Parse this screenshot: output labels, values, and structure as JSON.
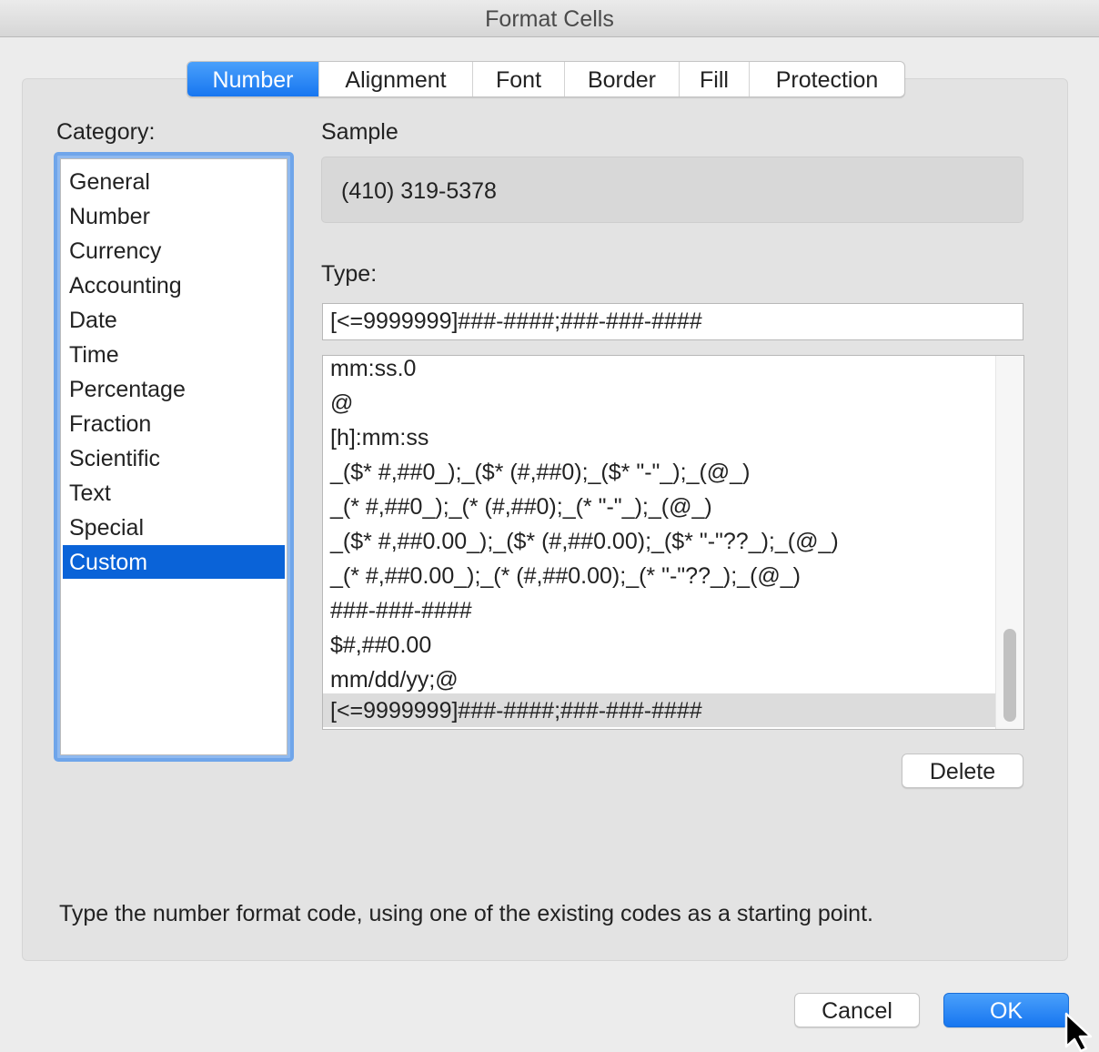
{
  "window": {
    "title": "Format Cells"
  },
  "tabs": [
    {
      "label": "Number",
      "active": true
    },
    {
      "label": "Alignment",
      "active": false
    },
    {
      "label": "Font",
      "active": false
    },
    {
      "label": "Border",
      "active": false
    },
    {
      "label": "Fill",
      "active": false
    },
    {
      "label": "Protection",
      "active": false
    }
  ],
  "category": {
    "label": "Category:",
    "items": [
      "General",
      "Number",
      "Currency",
      "Accounting",
      "Date",
      "Time",
      "Percentage",
      "Fraction",
      "Scientific",
      "Text",
      "Special",
      "Custom"
    ],
    "selected": "Custom"
  },
  "sample": {
    "label": "Sample",
    "value": "(410) 319-5378"
  },
  "type": {
    "label": "Type:",
    "value": "[<=9999999]###-####;###-###-####",
    "formats": [
      "mm:ss.0",
      "@",
      "[h]:mm:ss",
      "_($* #,##0_);_($* (#,##0);_($* \"-\"_);_(@_)",
      "_(* #,##0_);_(* (#,##0);_(* \"-\"_);_(@_)",
      "_($* #,##0.00_);_($* (#,##0.00);_($* \"-\"??_);_(@_)",
      "_(* #,##0.00_);_(* (#,##0.00);_(* \"-\"??_);_(@_)",
      "###-###-####",
      "$#,##0.00",
      "mm/dd/yy;@",
      "[<=9999999]###-####;###-###-####"
    ],
    "selected_format": "[<=9999999]###-####;###-###-####"
  },
  "buttons": {
    "delete": "Delete",
    "cancel": "Cancel",
    "ok": "OK"
  },
  "hint": "Type the number format code, using one of the existing codes as a starting point.",
  "colors": {
    "accent": "#1776f0",
    "selection": "#0a63d8",
    "focus_ring": "#6fa5ea"
  }
}
